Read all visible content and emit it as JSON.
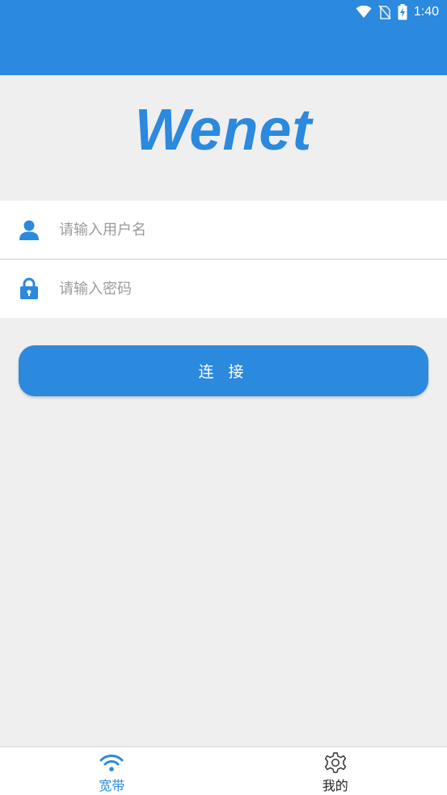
{
  "status_bar": {
    "time": "1:40",
    "icons": [
      "wifi-icon",
      "no-sim-icon",
      "battery-charging-icon"
    ]
  },
  "logo": {
    "text": "Wenet"
  },
  "login_form": {
    "username_placeholder": "请输入用户名",
    "username_value": "",
    "password_placeholder": "请输入密码",
    "password_value": "",
    "username_icon": "user-icon",
    "password_icon": "lock-icon"
  },
  "actions": {
    "connect_label": "连 接"
  },
  "bottom_nav": {
    "tabs": [
      {
        "label": "宽带",
        "icon": "wifi-icon",
        "active": true
      },
      {
        "label": "我的",
        "icon": "gear-icon",
        "active": false
      }
    ]
  },
  "colors": {
    "primary": "#2b89de",
    "background": "#efefef",
    "surface": "#ffffff"
  }
}
